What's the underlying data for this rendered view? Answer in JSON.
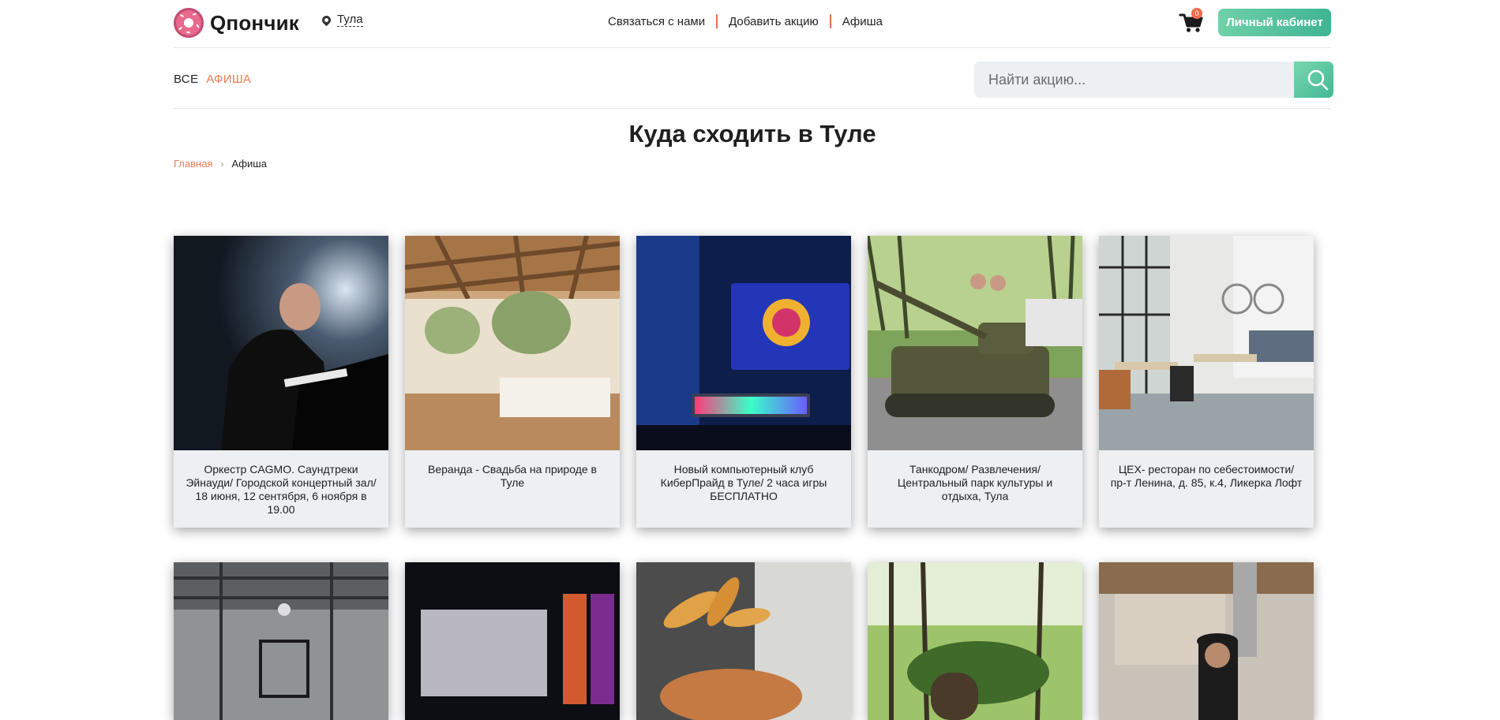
{
  "header": {
    "logo_text": "Qпончик",
    "city": "Тула",
    "nav": [
      {
        "label": "Связаться с нами"
      },
      {
        "label": "Добавить акцию"
      },
      {
        "label": "Афиша"
      }
    ],
    "cart_count": "0",
    "account_label": "Личный кабинет"
  },
  "filters": [
    {
      "label": "ВСЕ",
      "active": false
    },
    {
      "label": "АФИША",
      "active": true
    }
  ],
  "search": {
    "placeholder": "Найти акцию..."
  },
  "page": {
    "title": "Куда сходить в Туле",
    "breadcrumb": {
      "home": "Главная",
      "current": "Афиша"
    }
  },
  "cards": [
    {
      "caption": "Оркестр CAGMO. Саундтреки Эйнауди/ Городской концертный зал/ 18 июня, 12 сентября, 6 ноября в 19.00",
      "image": "pianist-photo"
    },
    {
      "caption": "Веранда - Свадьба на природе в Туле",
      "image": "wedding-veranda-photo"
    },
    {
      "caption": "Новый компьютерный клуб КиберПрайд в Туле/ 2 часа игры БЕСПЛАТНО",
      "image": "gaming-setup-photo"
    },
    {
      "caption": "Танкодром/ Развлечения/ Центральный парк культуры и отдыха, Тула",
      "image": "tank-photo"
    },
    {
      "caption": "ЦЕХ- ресторан по себестоимости/ пр-т Ленина, д. 85, к.4, Ликерка Лофт",
      "image": "restaurant-interior-photo"
    }
  ],
  "cards_row2": [
    {
      "image": "industrial-hall-photo"
    },
    {
      "image": "cinema-hall-photo"
    },
    {
      "image": "food-photo"
    },
    {
      "image": "forest-cabin-photo"
    },
    {
      "image": "chef-kitchen-photo"
    }
  ],
  "colors": {
    "accent": "#ee7a55",
    "brand_green": "#4dbf98",
    "card_bg": "#edf0f2"
  }
}
